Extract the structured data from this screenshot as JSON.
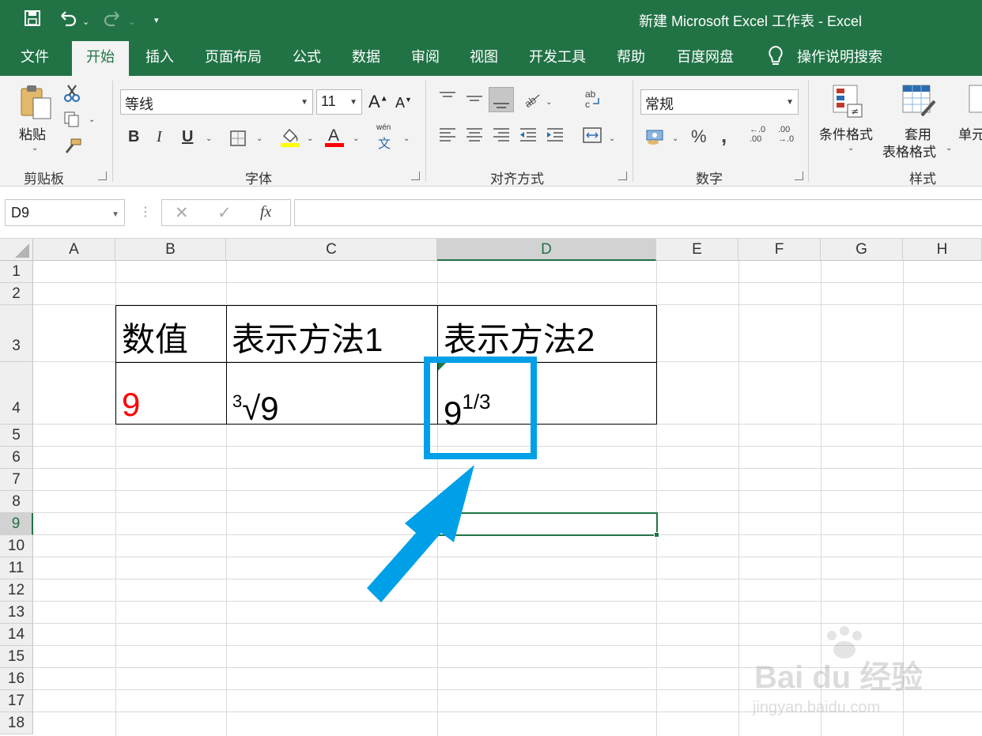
{
  "titlebar": {
    "title": "新建 Microsoft Excel 工作表  -  Excel",
    "save_icon": "save-icon",
    "undo_icon": "undo-icon",
    "redo_icon": "redo-icon",
    "customize_icon": "customize-icon"
  },
  "tabs": [
    "文件",
    "开始",
    "插入",
    "页面布局",
    "公式",
    "数据",
    "审阅",
    "视图",
    "开发工具",
    "帮助",
    "百度网盘",
    "操作说明搜索"
  ],
  "active_tab": "开始",
  "ribbon": {
    "clipboard": {
      "label": "剪贴板",
      "paste": "粘贴"
    },
    "font": {
      "label": "字体",
      "font_name": "等线",
      "font_size": "11",
      "bold": "B",
      "italic": "I",
      "underline": "U",
      "phonetic_top": "wén",
      "phonetic_bottom": "文",
      "fill_color": "#ffff00",
      "font_color": "#ff0000"
    },
    "alignment": {
      "label": "对齐方式"
    },
    "number": {
      "label": "数字",
      "format": "常规",
      "percent": "%",
      "comma": ",",
      "inc_decimal_top": "←.0",
      "inc_decimal_bottom": ".00",
      "dec_decimal_top": ".00",
      "dec_decimal_bottom": "→.0"
    },
    "styles": {
      "label": "样式",
      "conditional": "条件格式",
      "table_line1": "套用",
      "table_line2": "表格格式",
      "cell": "单元"
    }
  },
  "formula_bar": {
    "name_box": "D9",
    "cancel": "✕",
    "enter": "✓",
    "fx": "fx",
    "formula": ""
  },
  "grid": {
    "columns": [
      "A",
      "B",
      "C",
      "D",
      "E",
      "F",
      "G",
      "H"
    ],
    "rows": [
      "1",
      "2",
      "3",
      "4",
      "5",
      "6",
      "7",
      "8",
      "9",
      "10",
      "11",
      "12",
      "13",
      "14",
      "15",
      "16",
      "17",
      "18"
    ],
    "selected_cell": "D9",
    "cells": {
      "B3": "数值",
      "C3": "表示方法1",
      "D3": "表示方法2",
      "B4": "9",
      "C4_index": "3",
      "C4_radical": "√9",
      "D4_base": "9",
      "D4_exponent": "1/3"
    },
    "value_color": "#ff0000"
  },
  "annotation": {
    "highlight_color": "#00a0e9"
  },
  "watermark": {
    "logo": "Bai du 经验",
    "url": "jingyan.baidu.com"
  }
}
